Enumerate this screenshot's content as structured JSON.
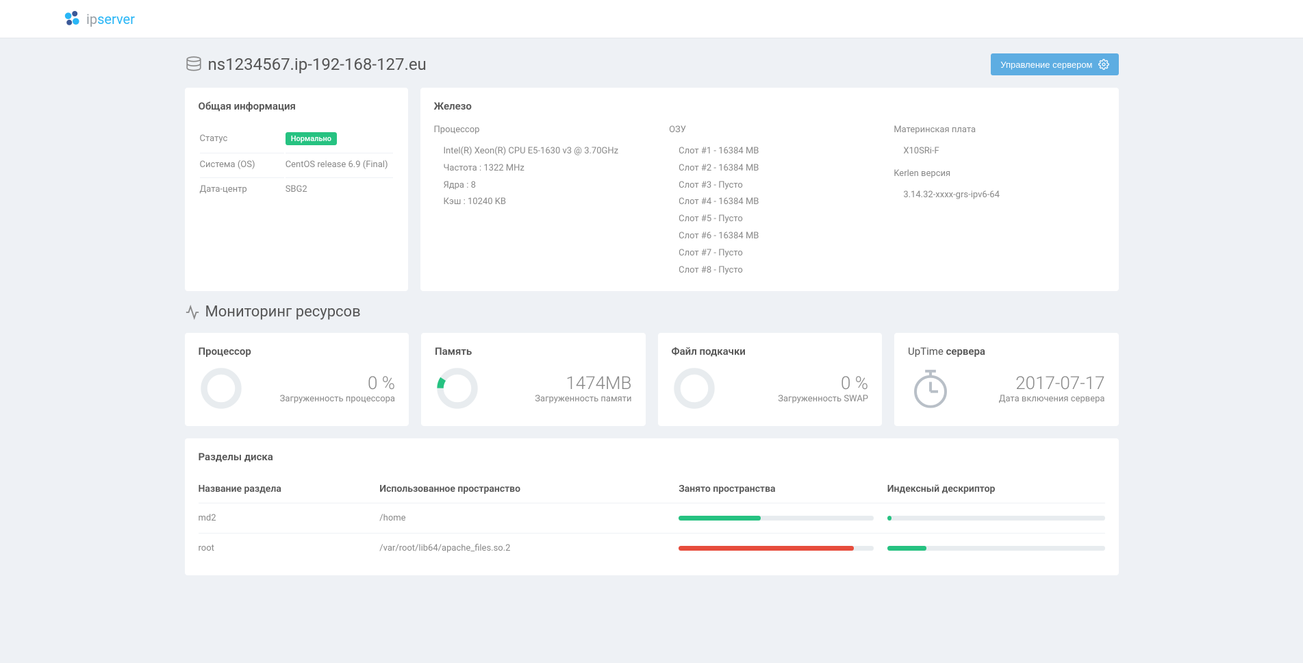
{
  "brand": {
    "ip": "ip",
    "server": "server"
  },
  "header": {
    "hostname": "ns1234567.ip-192-168-127.eu",
    "manage_label": "Управление сервером"
  },
  "general": {
    "title": "Общая информация",
    "status_label": "Статус",
    "status_value": "Нормально",
    "os_label": "Система (OS)",
    "os_value": "CentOS release 6.9 (Final)",
    "dc_label": "Дата-центр",
    "dc_value": "SBG2"
  },
  "hardware": {
    "title": "Железо",
    "cpu_label": "Процессор",
    "cpu_model": "Intel(R) Xeon(R) CPU E5-1630 v3 @ 3.70GHz",
    "cpu_freq": "Частота : 1322 MHz",
    "cpu_cores": "Ядра : 8",
    "cpu_cache": "Кэш : 10240 KB",
    "ram_label": "ОЗУ",
    "ram_slots": [
      "Слот #1 - 16384 MB",
      "Слот #2 - 16384 MB",
      "Слот #3 - Пусто",
      "Слот #4 - 16384 MB",
      "Слот #5 - Пусто",
      "Слот #6 - 16384 MB",
      "Слот #7 - Пусто",
      "Слот #8 - Пусто"
    ],
    "mb_label": "Материнская плата",
    "mb_value": "X10SRi-F",
    "kernel_label": "Kerlen версия",
    "kernel_value": "3.14.32-xxxx-grs-ipv6-64"
  },
  "monitoring": {
    "title": "Мониторинг ресурсов",
    "cpu": {
      "title": "Процессор",
      "value": "0 %",
      "sub": "Загруженность процессора",
      "percent": 0
    },
    "mem": {
      "title": "Память",
      "value": "1474MB",
      "sub": "Загруженность памяти",
      "percent": 9
    },
    "swap": {
      "title": "Файл подкачки",
      "value": "0 %",
      "sub": "Загруженность SWAP",
      "percent": 0
    },
    "uptime": {
      "title_thin": "UpTime",
      "title_bold": "сервера",
      "value": "2017-07-17",
      "sub": "Дата включения сервера"
    }
  },
  "disk": {
    "title": "Разделы диска",
    "cols": [
      "Название раздела",
      "Использованное пространство",
      "Занято пространства",
      "Индексный дескриптор"
    ],
    "rows": [
      {
        "name": "md2",
        "path": "/home",
        "used_pct": 42,
        "used_color": "green",
        "inode_pct": 2,
        "inode_color": "green"
      },
      {
        "name": "root",
        "path": "/var/root/lib64/apache_files.so.2",
        "used_pct": 90,
        "used_color": "red",
        "inode_pct": 18,
        "inode_color": "green"
      }
    ]
  }
}
